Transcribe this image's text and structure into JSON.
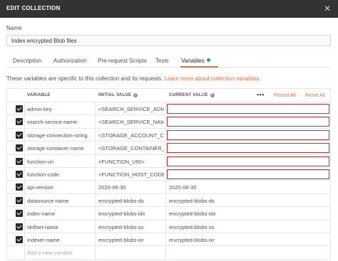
{
  "window": {
    "title": "EDIT COLLECTION",
    "close": "✕"
  },
  "name": {
    "label": "Name",
    "value": "Index encrypted Blob files"
  },
  "tabs": [
    {
      "label": "Description"
    },
    {
      "label": "Authorization"
    },
    {
      "label": "Pre-request Scripts"
    },
    {
      "label": "Tests"
    },
    {
      "label": "Variables",
      "active": true
    }
  ],
  "info": {
    "text": "These variables are specific to this collection and its requests. ",
    "link": "Learn more about collection variables."
  },
  "table": {
    "headers": {
      "variable": "VARIABLE",
      "initial": "INITIAL VALUE",
      "current": "CURRENT VALUE"
    },
    "menu": "•••",
    "persist_all": "Persist All",
    "reset_all": "Reset All",
    "rows": [
      {
        "key": "admin-key",
        "initial": "<SEARCH_SERVICE_ADMIN_",
        "current": ""
      },
      {
        "key": "search-service-name",
        "initial": "<SEARCH_SERVICE_NAME>",
        "current": ""
      },
      {
        "key": "storage-connection-string",
        "initial": "<STORAGE_ACCOUNT_CON",
        "current": ""
      },
      {
        "key": "storage-container-name",
        "initial": "<STORAGE_CONTAINER_NA",
        "current": ""
      },
      {
        "key": "function-uri",
        "initial": "<FUNCTION_URI>",
        "current": ""
      },
      {
        "key": "function-code",
        "initial": "<FUNCTION_HOST_CODE>",
        "current": ""
      },
      {
        "key": "api-version",
        "initial": "2020-06-30",
        "current": "2020-06-30"
      },
      {
        "key": "datasource-name",
        "initial": "encrypted-blobs-ds",
        "current": "encrypted-blobs-ds"
      },
      {
        "key": "index-name",
        "initial": "encrypted-blobs-idx",
        "current": "encrypted-blobs-idx"
      },
      {
        "key": "skillset-name",
        "initial": "encrypted-blobs-ss",
        "current": "encrypted-blobs-ss"
      },
      {
        "key": "indexer-name",
        "initial": "encrypted-blobs-ixr",
        "current": "encrypted-blobs-ixr"
      }
    ],
    "new_row_placeholder": "Add a new variable"
  },
  "colors": {
    "accent": "#f26b3a",
    "highlight": "#c0302e",
    "status_dot": "#2fa84f",
    "titlebar": "#333333"
  }
}
